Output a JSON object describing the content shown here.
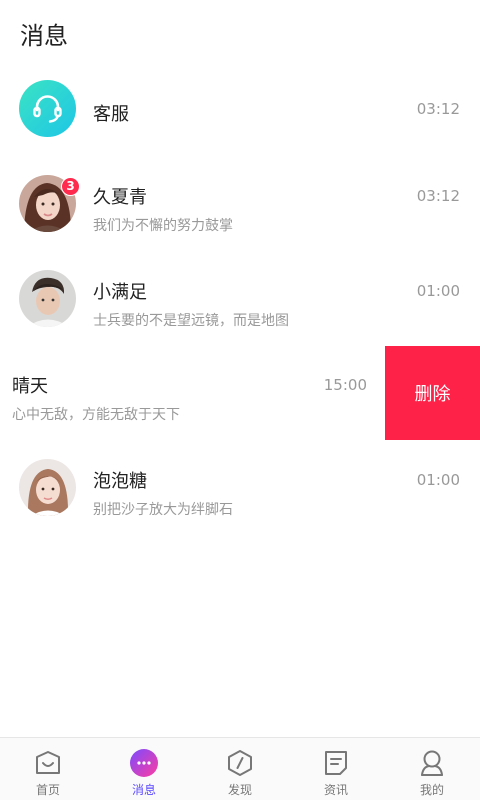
{
  "header": {
    "title": "消息"
  },
  "conversations": [
    {
      "name": "客服",
      "message": "",
      "time": "03:12",
      "avatar": "customer-service-icon"
    },
    {
      "name": "久夏青",
      "message": "我们为不懈的努力鼓掌",
      "time": "03:12",
      "avatar": "user-photo",
      "unread": "3"
    },
    {
      "name": "小满足",
      "message": "士兵要的不是望远镜，而是地图",
      "time": "01:00",
      "avatar": "user-photo"
    },
    {
      "name": "晴天",
      "message": "心中无敌，方能无敌于天下",
      "time": "15:00",
      "swiped": true,
      "action_label": "删除"
    },
    {
      "name": "泡泡糖",
      "message": "别把沙子放大为绊脚石",
      "time": "01:00",
      "avatar": "user-photo"
    }
  ],
  "tabbar": {
    "active": "消息",
    "items": [
      {
        "label": "首页",
        "icon": "home-icon"
      },
      {
        "label": "消息",
        "icon": "message-icon"
      },
      {
        "label": "发现",
        "icon": "discover-icon"
      },
      {
        "label": "资讯",
        "icon": "news-icon"
      },
      {
        "label": "我的",
        "icon": "profile-icon"
      }
    ]
  },
  "colors": {
    "accent_teal": "#2ed8d0",
    "delete_red": "#fe2248",
    "badge_red": "#ff2b4e",
    "active_tab": "#5d4bff"
  }
}
